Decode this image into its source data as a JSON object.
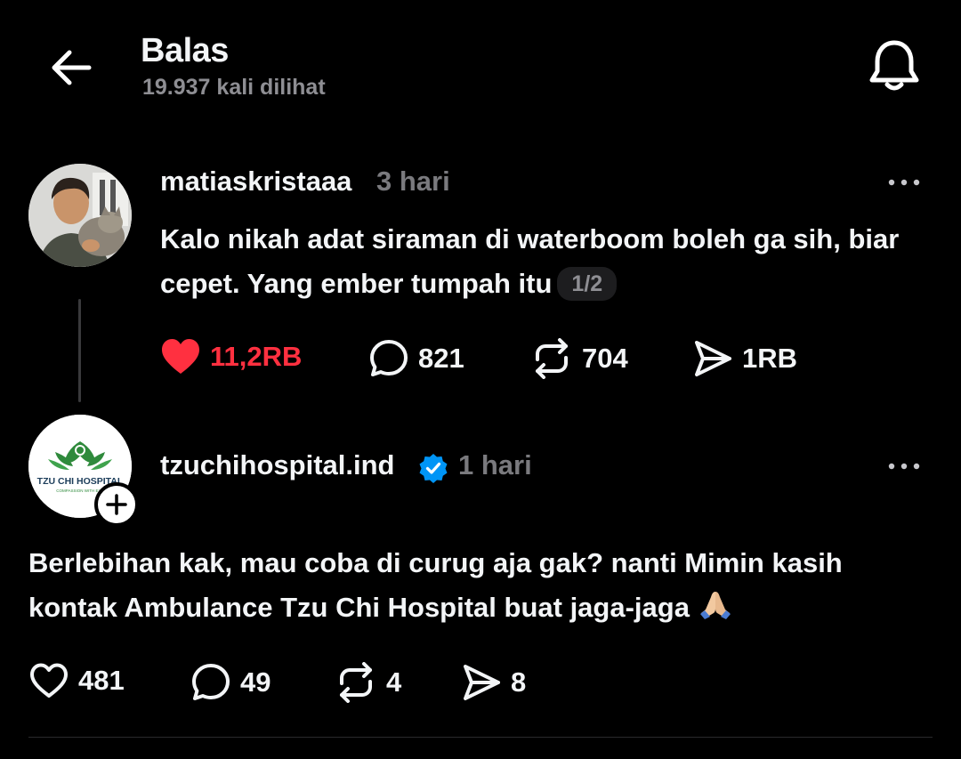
{
  "header": {
    "title": "Balas",
    "views": "19.937 kali dilihat"
  },
  "post1": {
    "username": "matiaskristaaa",
    "time": "3 hari",
    "text": "Kalo nikah adat siraman di waterboom boleh ga sih, biar cepet. Yang ember tumpah itu",
    "pager": "1/2",
    "likes": "11,2RB",
    "replies": "821",
    "reposts": "704",
    "shares": "1RB",
    "liked": true,
    "like_color": "#ff3040"
  },
  "post2": {
    "username": "tzuchihospital.ind",
    "verified": true,
    "time": "1 hari",
    "avatar_logo_text": "TZU CHI HOSPITAL",
    "avatar_logo_subtext": "COMPASSION WITH EXC",
    "text": "Berlebihan kak, mau coba di curug aja gak? nanti Mimin kasih kontak Ambulance Tzu Chi Hospital buat jaga-jaga",
    "emoji": "folded-hands",
    "likes": "481",
    "replies": "49",
    "reposts": "4",
    "shares": "8"
  },
  "icons": {
    "back": "arrow-left-icon",
    "notification": "bell-icon",
    "more": "more-horizontal-icon",
    "like": "heart-icon",
    "reply": "comment-bubble-icon",
    "repost": "repost-icon",
    "share": "send-icon",
    "verified": "verified-badge-icon",
    "follow": "plus-icon"
  },
  "colors": {
    "background": "#000000",
    "text": "#f3f5f7",
    "muted": "#8e8e93",
    "verified": "#0095f6"
  }
}
